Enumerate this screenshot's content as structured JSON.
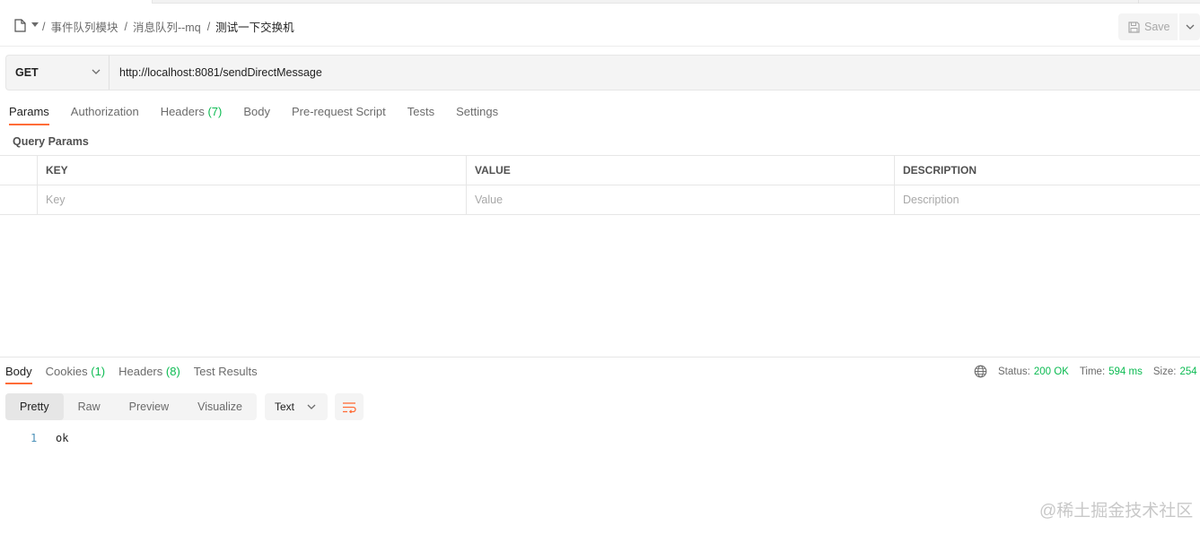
{
  "breadcrumb": {
    "items": [
      "事件队列模块",
      "消息队列--mq",
      "测试一下交换机"
    ],
    "separator": "/"
  },
  "header": {
    "save_label": "Save"
  },
  "request": {
    "method": "GET",
    "url": "http://localhost:8081/sendDirectMessage"
  },
  "request_tabs": [
    {
      "label": "Params",
      "count": "",
      "active": true
    },
    {
      "label": "Authorization",
      "count": "",
      "active": false
    },
    {
      "label": "Headers",
      "count": "(7)",
      "active": false
    },
    {
      "label": "Body",
      "count": "",
      "active": false
    },
    {
      "label": "Pre-request Script",
      "count": "",
      "active": false
    },
    {
      "label": "Tests",
      "count": "",
      "active": false
    },
    {
      "label": "Settings",
      "count": "",
      "active": false
    }
  ],
  "query_params": {
    "title": "Query Params",
    "columns": [
      "KEY",
      "VALUE",
      "DESCRIPTION"
    ],
    "placeholders": [
      "Key",
      "Value",
      "Description"
    ]
  },
  "response_tabs": [
    {
      "label": "Body",
      "count": "",
      "active": true
    },
    {
      "label": "Cookies",
      "count": "(1)",
      "active": false
    },
    {
      "label": "Headers",
      "count": "(8)",
      "active": false
    },
    {
      "label": "Test Results",
      "count": "",
      "active": false
    }
  ],
  "response_meta": {
    "status_label": "Status:",
    "status_value": "200 OK",
    "time_label": "Time:",
    "time_value": "594 ms",
    "size_label": "Size:",
    "size_value": "254"
  },
  "view_modes": [
    "Pretty",
    "Raw",
    "Preview",
    "Visualize"
  ],
  "active_view": "Pretty",
  "body_type": "Text",
  "response_body": {
    "line_numbers": [
      "1"
    ],
    "lines": [
      "ok"
    ]
  },
  "watermark": "@稀土掘金技术社区",
  "colors": {
    "accent": "#ff6c37",
    "success": "#0cbb52",
    "muted": "#6b6b6b"
  }
}
